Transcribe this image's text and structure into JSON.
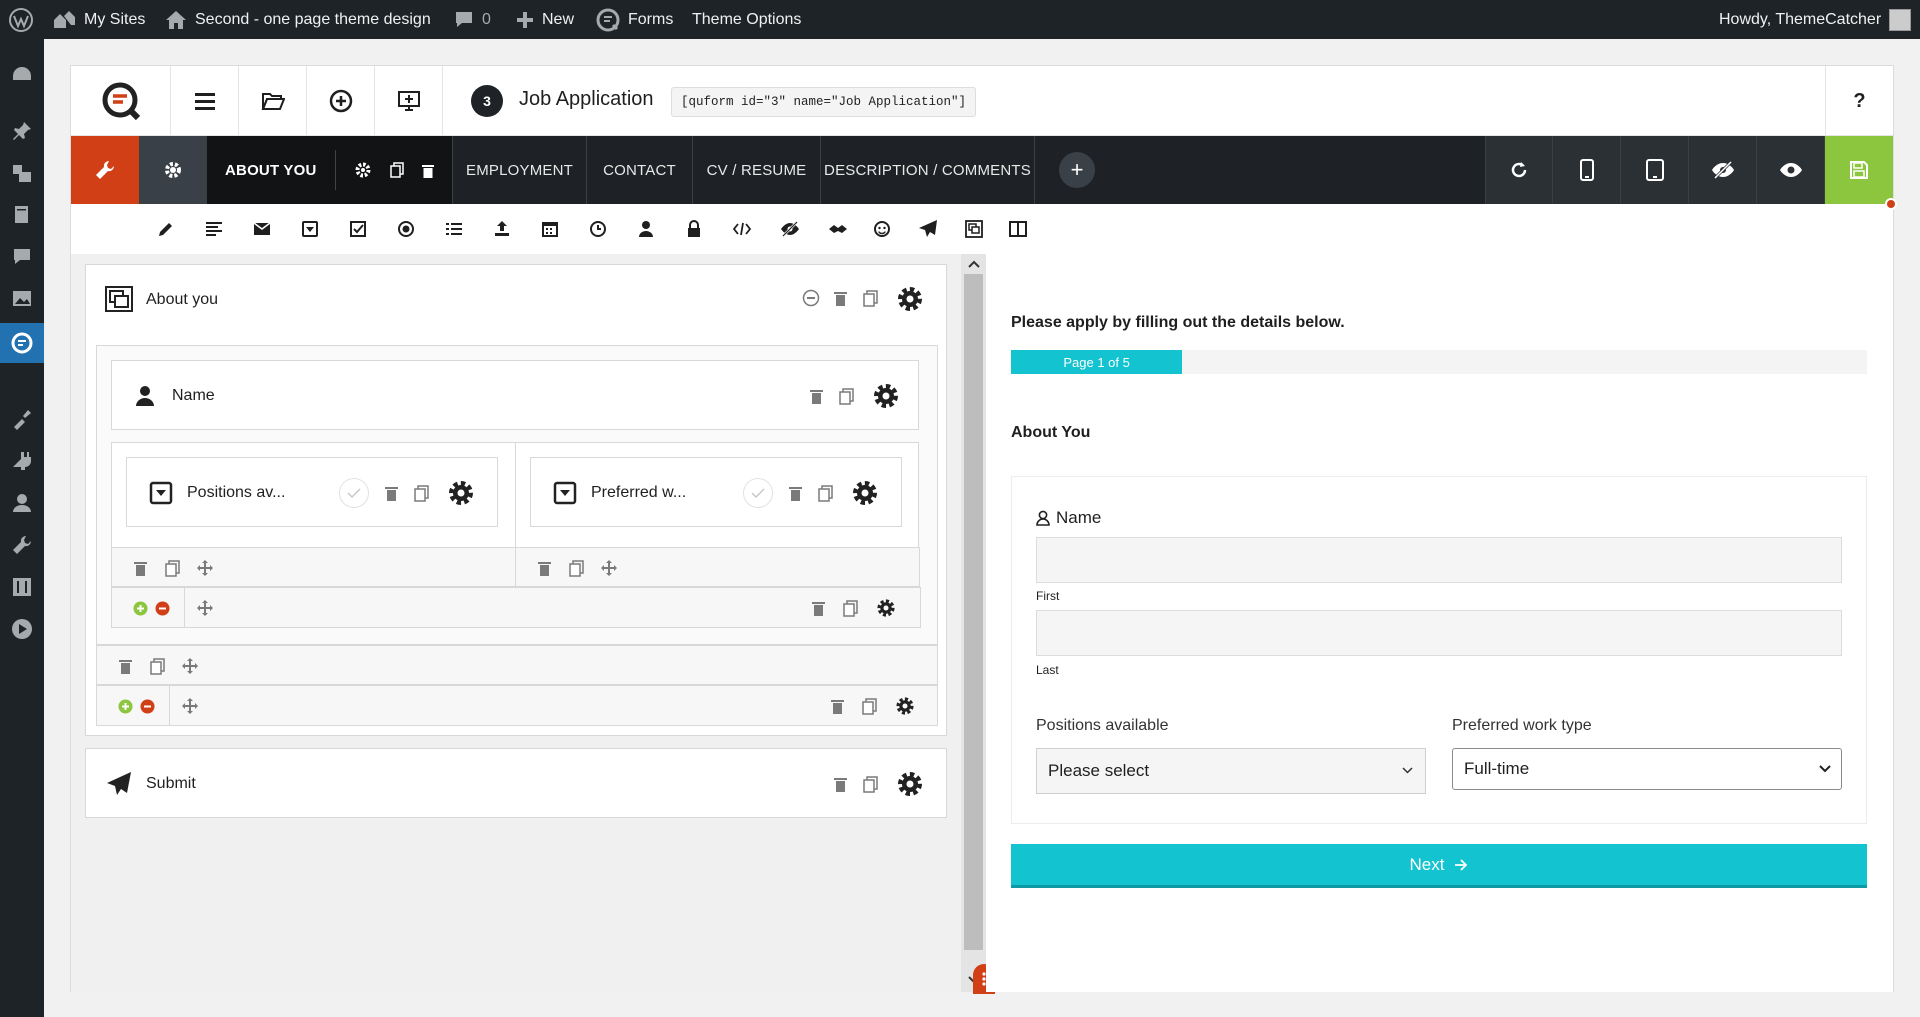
{
  "adminbar": {
    "my_sites": "My Sites",
    "site_name": "Second - one page theme design",
    "comments_count": "0",
    "new_label": "New",
    "forms_label": "Forms",
    "theme_options": "Theme Options",
    "howdy": "Howdy, ThemeCatcher"
  },
  "admin_menu_icons": [
    "dashboard-icon",
    "pin-icon",
    "media-icon",
    "pages-icon",
    "comments-icon",
    "gallery-icon",
    "quform-icon",
    "appearance-icon",
    "plugins-icon",
    "users-icon",
    "tools-icon",
    "settings-icon",
    "play-icon"
  ],
  "builder": {
    "form_number": "3",
    "form_title": "Job Application",
    "shortcode": "[quform id=\"3\" name=\"Job Application\"]",
    "help": "?"
  },
  "tabs": {
    "active": "ABOUT YOU",
    "items": [
      "EMPLOYMENT",
      "CONTACT",
      "CV / RESUME",
      "DESCRIPTION / COMMENTS"
    ],
    "add": "+"
  },
  "colors": {
    "accent_red": "#d13f17",
    "accent_green": "#8cc63f",
    "teal": "#13c3cf",
    "dark": "#1e2226"
  },
  "field_toolbar_icons": [
    "pencil-icon",
    "paragraph-icon",
    "email-icon",
    "select-icon",
    "checkbox-icon",
    "radio-icon",
    "list-icon",
    "upload-icon",
    "calendar-icon",
    "clock-icon",
    "user-icon",
    "lock-icon",
    "code-icon",
    "hidden-icon",
    "captcha-icon",
    "recaptcha-icon",
    "submit-icon",
    "group-icon",
    "columns-icon"
  ],
  "editor": {
    "group_label": "About you",
    "name_label": "Name",
    "positions_label": "Positions av...",
    "preferred_label": "Preferred w...",
    "submit_label": "Submit"
  },
  "preview": {
    "intro": "Please apply by filling out the details below.",
    "progress_text": "Page 1 of 5",
    "progress_value": 0.2,
    "section_title": "About You",
    "name_label": "Name",
    "first_label": "First",
    "last_label": "Last",
    "positions_label": "Positions available",
    "positions_value": "Please select",
    "worktype_label": "Preferred work type",
    "worktype_value": "Full-time",
    "next_label": "Next"
  }
}
